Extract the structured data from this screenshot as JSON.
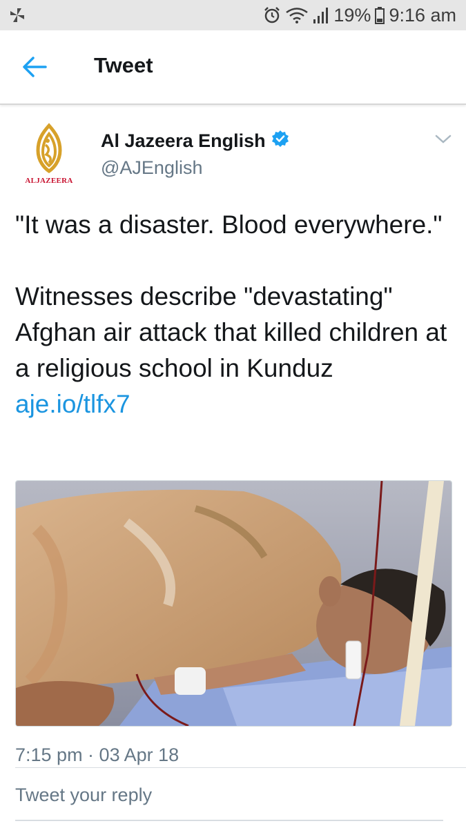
{
  "status_bar": {
    "battery": "19%",
    "time": "9:16 am"
  },
  "header": {
    "title": "Tweet"
  },
  "tweet": {
    "author": {
      "name": "Al Jazeera English",
      "handle": "@AJEnglish",
      "verified": true,
      "avatar_label": "ALJAZEERA"
    },
    "text_line1": "\"It was a disaster. Blood everywhere.\"",
    "text_line2": "Witnesses describe \"devastating\" Afghan air attack that killed children at a religious school in Kunduz",
    "link": "aje.io/tlfx7",
    "timestamp": "7:15 pm · 03 Apr 18"
  },
  "reply": {
    "placeholder": "Tweet your reply"
  },
  "colors": {
    "link": "#1b95e0",
    "verified": "#1da1f2",
    "status_bar_bg": "#e6e6e6",
    "secondary_text": "#657786",
    "brand_gold": "#d7a12a"
  }
}
